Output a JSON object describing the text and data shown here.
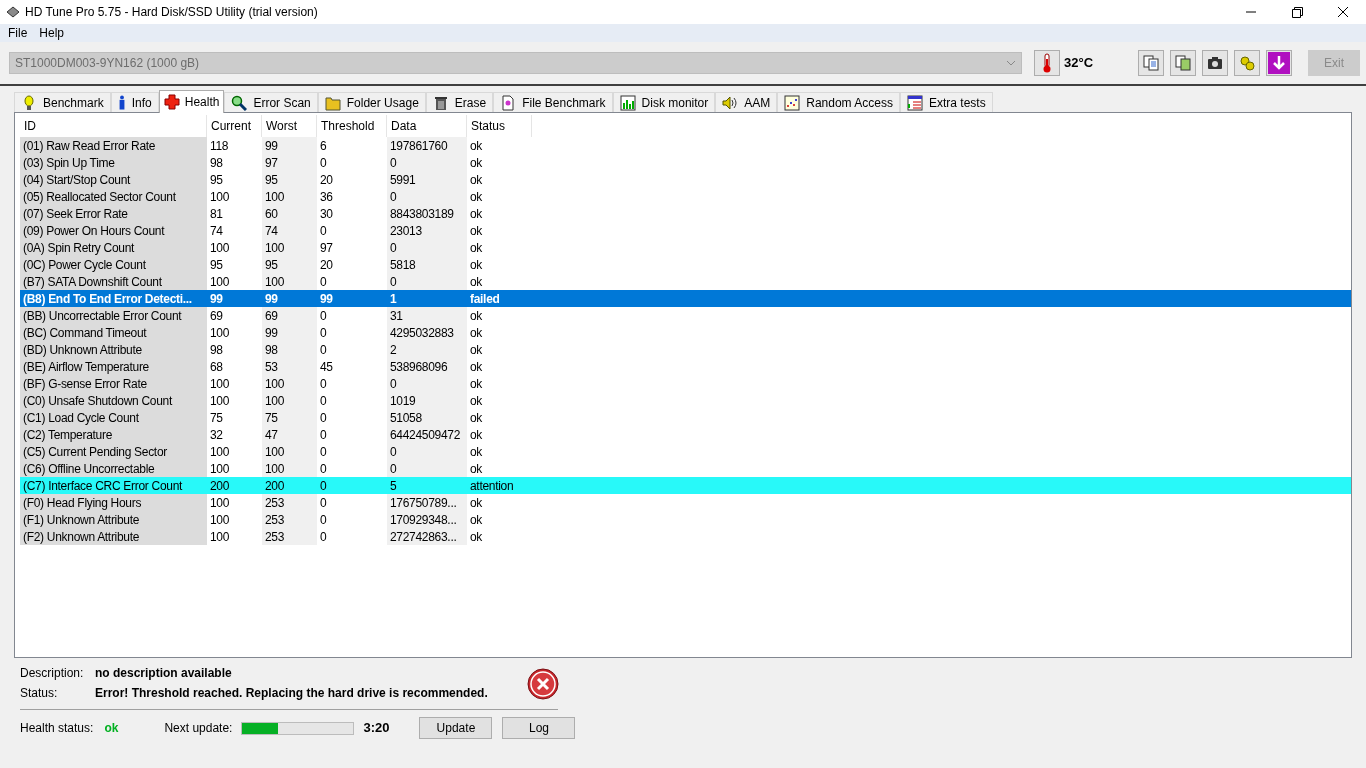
{
  "window": {
    "title": "HD Tune Pro 5.75 - Hard Disk/SSD Utility (trial version)"
  },
  "menu": [
    {
      "label": "File"
    },
    {
      "label": "Help"
    }
  ],
  "toolbar": {
    "drive": "ST1000DM003-9YN162 (1000 gB)",
    "temperature": "32°C",
    "exit_button": "Exit"
  },
  "tabs": [
    {
      "label": "Benchmark",
      "selected": false
    },
    {
      "label": "Info",
      "selected": false
    },
    {
      "label": "Health",
      "selected": true
    },
    {
      "label": "Error Scan",
      "selected": false
    },
    {
      "label": "Folder Usage",
      "selected": false
    },
    {
      "label": "Erase",
      "selected": false
    },
    {
      "label": "File Benchmark",
      "selected": false
    },
    {
      "label": "Disk monitor",
      "selected": false
    },
    {
      "label": "AAM",
      "selected": false
    },
    {
      "label": "Random Access",
      "selected": false
    },
    {
      "label": "Extra tests",
      "selected": false
    }
  ],
  "table": {
    "columns": [
      "ID",
      "Current",
      "Worst",
      "Threshold",
      "Data",
      "Status"
    ],
    "rows": [
      {
        "cells": [
          "(01) Raw Read Error Rate",
          "118",
          "99",
          "6",
          "197861760",
          "ok"
        ],
        "kind": "ok",
        "selected": false
      },
      {
        "cells": [
          "(03) Spin Up Time",
          "98",
          "97",
          "0",
          "0",
          "ok"
        ],
        "kind": "ok",
        "selected": false
      },
      {
        "cells": [
          "(04) Start/Stop Count",
          "95",
          "95",
          "20",
          "5991",
          "ok"
        ],
        "kind": "ok",
        "selected": false
      },
      {
        "cells": [
          "(05) Reallocated Sector Count",
          "100",
          "100",
          "36",
          "0",
          "ok"
        ],
        "kind": "ok",
        "selected": false
      },
      {
        "cells": [
          "(07) Seek Error Rate",
          "81",
          "60",
          "30",
          "8843803189",
          "ok"
        ],
        "kind": "ok",
        "selected": false
      },
      {
        "cells": [
          "(09) Power On Hours Count",
          "74",
          "74",
          "0",
          "23013",
          "ok"
        ],
        "kind": "ok",
        "selected": false
      },
      {
        "cells": [
          "(0A) Spin Retry Count",
          "100",
          "100",
          "97",
          "0",
          "ok"
        ],
        "kind": "ok",
        "selected": false
      },
      {
        "cells": [
          "(0C) Power Cycle Count",
          "95",
          "95",
          "20",
          "5818",
          "ok"
        ],
        "kind": "ok",
        "selected": false
      },
      {
        "cells": [
          "(B7) SATA Downshift Count",
          "100",
          "100",
          "0",
          "0",
          "ok"
        ],
        "kind": "ok",
        "selected": false
      },
      {
        "cells": [
          "(B8) End To End Error Detecti...",
          "99",
          "99",
          "99",
          "1",
          "failed"
        ],
        "kind": "failed",
        "selected": true
      },
      {
        "cells": [
          "(BB) Uncorrectable Error Count",
          "69",
          "69",
          "0",
          "31",
          "ok"
        ],
        "kind": "ok",
        "selected": false
      },
      {
        "cells": [
          "(BC) Command Timeout",
          "100",
          "99",
          "0",
          "4295032883",
          "ok"
        ],
        "kind": "ok",
        "selected": false
      },
      {
        "cells": [
          "(BD) Unknown Attribute",
          "98",
          "98",
          "0",
          "2",
          "ok"
        ],
        "kind": "ok",
        "selected": false
      },
      {
        "cells": [
          "(BE) Airflow Temperature",
          "68",
          "53",
          "45",
          "538968096",
          "ok"
        ],
        "kind": "ok",
        "selected": false
      },
      {
        "cells": [
          "(BF) G-sense Error Rate",
          "100",
          "100",
          "0",
          "0",
          "ok"
        ],
        "kind": "ok",
        "selected": false
      },
      {
        "cells": [
          "(C0) Unsafe Shutdown Count",
          "100",
          "100",
          "0",
          "1019",
          "ok"
        ],
        "kind": "ok",
        "selected": false
      },
      {
        "cells": [
          "(C1) Load Cycle Count",
          "75",
          "75",
          "0",
          "51058",
          "ok"
        ],
        "kind": "ok",
        "selected": false
      },
      {
        "cells": [
          "(C2) Temperature",
          "32",
          "47",
          "0",
          "64424509472",
          "ok"
        ],
        "kind": "ok",
        "selected": false
      },
      {
        "cells": [
          "(C5) Current Pending Sector",
          "100",
          "100",
          "0",
          "0",
          "ok"
        ],
        "kind": "ok",
        "selected": false
      },
      {
        "cells": [
          "(C6) Offline Uncorrectable",
          "100",
          "100",
          "0",
          "0",
          "ok"
        ],
        "kind": "ok",
        "selected": false
      },
      {
        "cells": [
          "(C7) Interface CRC Error Count",
          "200",
          "200",
          "0",
          "5",
          "attention"
        ],
        "kind": "attention",
        "selected": false
      },
      {
        "cells": [
          "(F0) Head Flying Hours",
          "100",
          "253",
          "0",
          "176750789...",
          "ok"
        ],
        "kind": "ok",
        "selected": false
      },
      {
        "cells": [
          "(F1) Unknown Attribute",
          "100",
          "253",
          "0",
          "170929348...",
          "ok"
        ],
        "kind": "ok",
        "selected": false
      },
      {
        "cells": [
          "(F2) Unknown Attribute",
          "100",
          "253",
          "0",
          "272742863...",
          "ok"
        ],
        "kind": "ok",
        "selected": false
      }
    ]
  },
  "details": {
    "description_label": "Description:",
    "description": "no description available",
    "status_label": "Status:",
    "status": "Error! Threshold reached. Replacing the hard drive is recommended."
  },
  "footer": {
    "health_label": "Health status:",
    "health": "ok",
    "next_update_label": "Next update:",
    "level": 0.32,
    "countdown": "3:20",
    "buttons": [
      "Update",
      "Log"
    ]
  }
}
